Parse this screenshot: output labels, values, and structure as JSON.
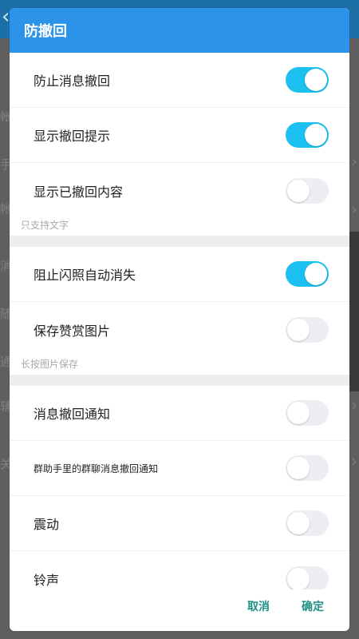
{
  "background": {
    "back_glyph": "‹",
    "left_glyphs": [
      "帐",
      "手",
      "帐",
      "消",
      "随",
      "通",
      "辅",
      "关"
    ],
    "right_chevron": "›"
  },
  "dialog": {
    "title": "防撤回",
    "items": [
      {
        "label": "防止消息撤回",
        "on": true
      },
      {
        "label": "显示撤回提示",
        "on": true
      },
      {
        "label": "显示已撤回内容",
        "on": false,
        "hint": "只支持文字"
      },
      {
        "label": "阻止闪照自动消失",
        "on": true
      },
      {
        "label": "保存赞赏图片",
        "on": false,
        "hint": "长按图片保存"
      },
      {
        "label": "消息撤回通知",
        "on": false
      },
      {
        "label": "群助手里的群聊消息撤回通知",
        "on": false
      },
      {
        "label": "震动",
        "on": false
      },
      {
        "label": "铃声",
        "on": false
      }
    ],
    "cancel_label": "取消",
    "confirm_label": "确定"
  }
}
